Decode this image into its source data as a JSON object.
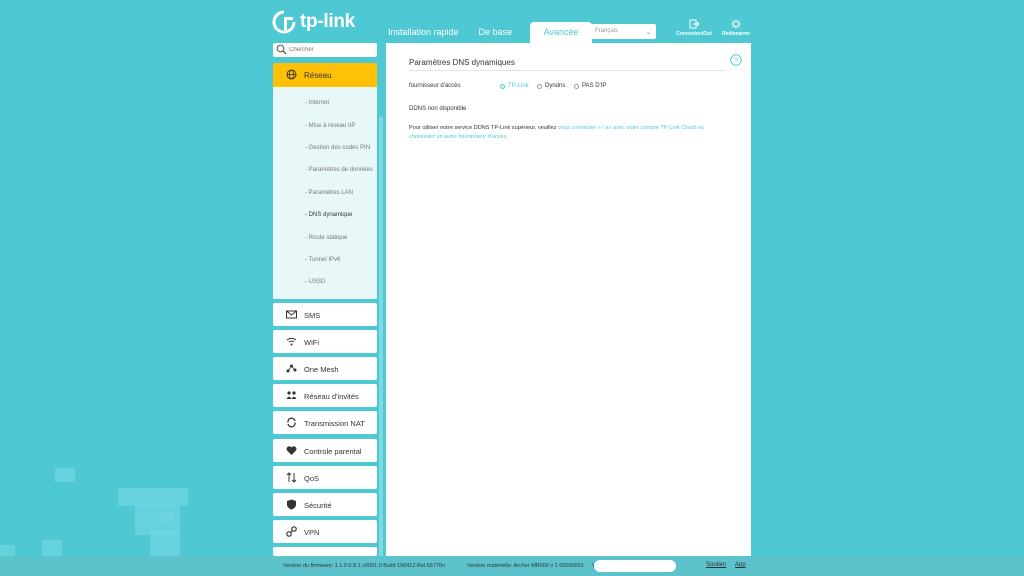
{
  "brand": {
    "name": "tp-link"
  },
  "tabs": [
    {
      "label": "Installation rapide"
    },
    {
      "label": "De base"
    },
    {
      "label": "Avancée",
      "active": true
    }
  ],
  "language": {
    "selected": "Français"
  },
  "top_buttons": {
    "logout": "Connexion/Out",
    "reboot": "Redémarrer"
  },
  "search": {
    "placeholder": "Chercher"
  },
  "sidebar": {
    "active": {
      "label": "Réseau",
      "icon": "globe-icon"
    },
    "subitems": [
      {
        "label": "- Internet"
      },
      {
        "label": "- Mise à réseau IIP"
      },
      {
        "label": "- Gestion des codes PIN"
      },
      {
        "label": "- Paramètres de données"
      },
      {
        "label": "- Paramètres LAN"
      },
      {
        "label": "- DNS dynamique",
        "current": true
      },
      {
        "label": "- Route statique"
      },
      {
        "label": "- Tunnel IPv6"
      },
      {
        "label": "- USSD"
      }
    ],
    "items": [
      {
        "label": "SMS",
        "icon": "envelope-icon"
      },
      {
        "label": "WiFi",
        "icon": "wifi-icon"
      },
      {
        "label": "One Mesh",
        "icon": "mesh-icon"
      },
      {
        "label": "Réseau d'invités",
        "icon": "guests-icon"
      },
      {
        "label": "Transmission NAT",
        "icon": "nat-icon"
      },
      {
        "label": "Controle parental",
        "icon": "heart-icon"
      },
      {
        "label": "QoS",
        "icon": "qos-icon"
      },
      {
        "label": "Sécurité",
        "icon": "shield-icon"
      },
      {
        "label": "VPN",
        "icon": "vpn-icon"
      }
    ]
  },
  "panel": {
    "title": "Paramètres DNS dynamiques",
    "provider_label": "fournisseur d'accès",
    "providers": [
      {
        "label": "TP-Link",
        "selected": true
      },
      {
        "label": "Dyndns",
        "selected": false
      },
      {
        "label": "PAS D'IP",
        "selected": false
      }
    ],
    "status": "DDNS non disponible",
    "info_prefix": "Pour utiliser notre service DDNS TP-Link supérieur, veuillez",
    "info_link1": "vous connecter » / a» avec votre compte TP-Link Cloud ou",
    "info_link2": "choisissez un autre fournisseur d'accès."
  },
  "footer": {
    "firmware": "Version du firmware: 1.1.0 0.9.1 v0001.0 Build 190412 Rel.65770n",
    "hardware": "Version matérielle: Archer MR600 v 1 00000001",
    "hardware_suffix": "V",
    "support": "Soutien",
    "app": "App"
  },
  "colors": {
    "accent": "#4ec9d4",
    "active_menu": "#ffc107",
    "background": "#4ec9d4"
  }
}
